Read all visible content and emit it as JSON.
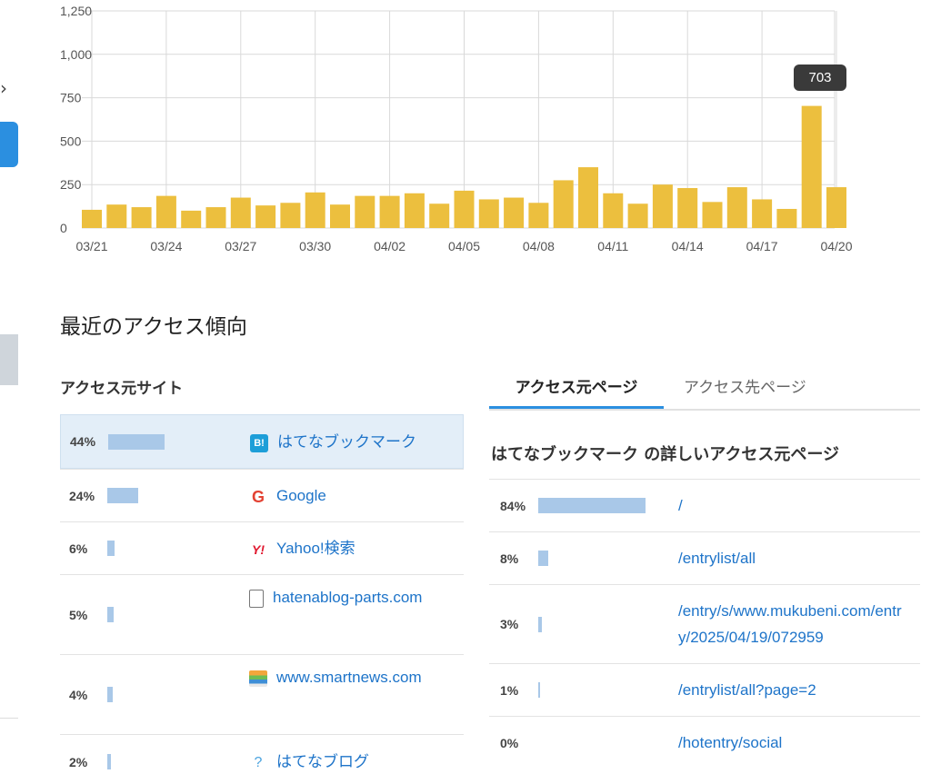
{
  "chart_data": {
    "type": "bar",
    "categories": [
      "03/21",
      "03/22",
      "03/23",
      "03/24",
      "03/25",
      "03/26",
      "03/27",
      "03/28",
      "03/29",
      "03/30",
      "03/31",
      "04/01",
      "04/02",
      "04/03",
      "04/04",
      "04/05",
      "04/06",
      "04/07",
      "04/08",
      "04/09",
      "04/10",
      "04/11",
      "04/12",
      "04/13",
      "04/14",
      "04/15",
      "04/16",
      "04/17",
      "04/18",
      "04/19",
      "04/20"
    ],
    "values": [
      105,
      135,
      120,
      185,
      100,
      120,
      175,
      130,
      145,
      205,
      135,
      185,
      185,
      200,
      140,
      215,
      165,
      175,
      145,
      275,
      350,
      200,
      140,
      250,
      230,
      150,
      235,
      165,
      110,
      703,
      235
    ],
    "x_tick_labels": [
      "03/21",
      "03/24",
      "03/27",
      "03/30",
      "04/02",
      "04/05",
      "04/08",
      "04/11",
      "04/14",
      "04/17",
      "04/20"
    ],
    "y_ticks": [
      "0",
      "250",
      "500",
      "750",
      "1,000",
      "1,250"
    ],
    "ylim": [
      0,
      1250
    ],
    "bar_color": "#ecbf3e",
    "grid": true,
    "title": "",
    "xlabel": "",
    "ylabel": ""
  },
  "tooltip": {
    "value": "703"
  },
  "section_title": "最近のアクセス傾向",
  "sources": {
    "title": "アクセス元サイト",
    "rows": [
      {
        "percent": "44%",
        "share": 0.44,
        "icon": "hatena-bookmark-icon",
        "icon_text": "B!",
        "name": "はてなブックマーク"
      },
      {
        "percent": "24%",
        "share": 0.24,
        "icon": "google-icon",
        "icon_text": "G",
        "name": "Google"
      },
      {
        "percent": "6%",
        "share": 0.06,
        "icon": "yahoo-icon",
        "icon_text": "Y!",
        "name": "Yahoo!検索"
      },
      {
        "percent": "5%",
        "share": 0.05,
        "icon": "document-icon",
        "icon_text": "",
        "name": "hatenablog-parts.com"
      },
      {
        "percent": "4%",
        "share": 0.04,
        "icon": "smartnews-icon",
        "icon_text": "",
        "name": "www.smartnews.com"
      },
      {
        "percent": "2%",
        "share": 0.02,
        "icon": "hatena-blog-icon",
        "icon_text": "?",
        "name": "はてなブログ"
      }
    ]
  },
  "tabs": {
    "active": "アクセス元ページ",
    "inactive": "アクセス先ページ"
  },
  "detail": {
    "title": "はてなブックマーク の詳しいアクセス元ページ",
    "rows": [
      {
        "percent": "84%",
        "share": 0.84,
        "path": "/"
      },
      {
        "percent": "8%",
        "share": 0.08,
        "path": "/entrylist/all"
      },
      {
        "percent": "3%",
        "share": 0.03,
        "path": "/entry/s/www.mukubeni.com/entry/2025/04/19/072959"
      },
      {
        "percent": "1%",
        "share": 0.01,
        "path": "/entrylist/all?page=2"
      },
      {
        "percent": "0%",
        "share": 0.0,
        "path": "/hotentry/social"
      }
    ]
  },
  "edge": {
    "chevron": "›"
  }
}
